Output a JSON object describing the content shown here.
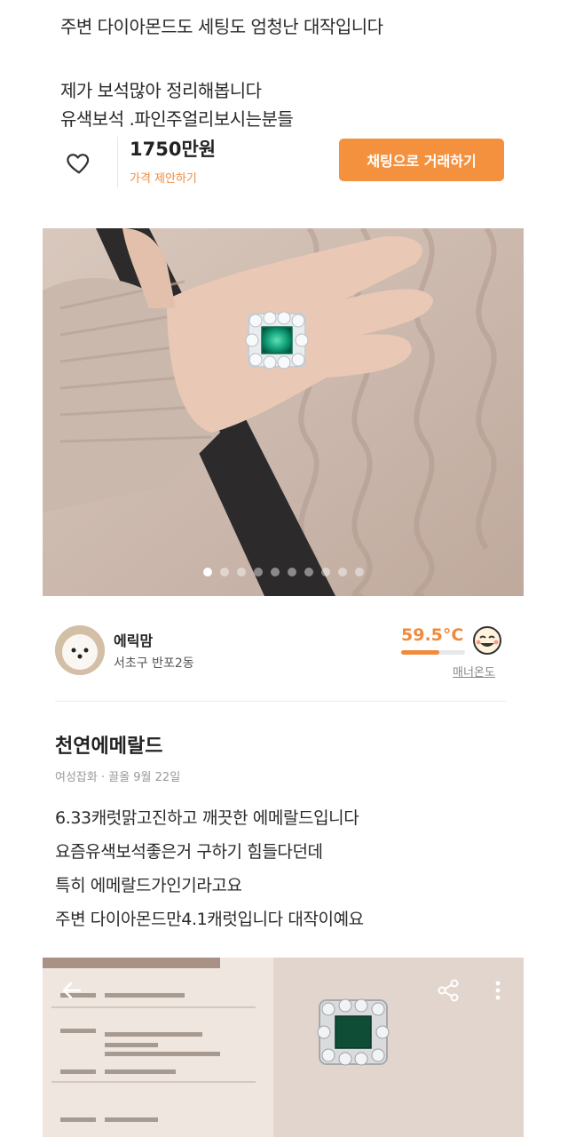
{
  "listing_top": {
    "line1": "주변 다이아몬드도 세팅도 엄청난 대작입니다",
    "line2": "제가 보석많아 정리해봅니다",
    "line3": "유색보석 .파인주얼리보시는분들"
  },
  "price_bar": {
    "price": "1750만원",
    "offer_label": "가격 제안하기",
    "chat_button": "채팅으로 거래하기",
    "like_icon": "heart-outline-icon"
  },
  "photo": {
    "dot_count": 10,
    "active_index": 0
  },
  "seller": {
    "nickname": "에릭맘",
    "location": "서초구 반포2동",
    "temperature": "59.5°C",
    "temperature_fraction": 0.595,
    "manner_label": "매너온도",
    "accent": "#f08a3c"
  },
  "post": {
    "title": "천연에메랄드",
    "meta": "여성잡화 · 끌올 9월 22일",
    "lines": [
      "6.33캐럿맑고진하고 깨끗한 에메랄드입니다",
      "요즘유색보석좋은거 구하기 힘들다던데",
      "특히 에메랄드가인기라고요",
      "주변 다이아몬드만4.1캐럿입니다 대작이예요"
    ]
  },
  "photo2": {
    "back_icon": "back-arrow-icon",
    "share_icon": "share-icon",
    "more_icon": "more-vertical-icon"
  },
  "colors": {
    "brand_orange": "#f4913f",
    "text": "#222222"
  }
}
